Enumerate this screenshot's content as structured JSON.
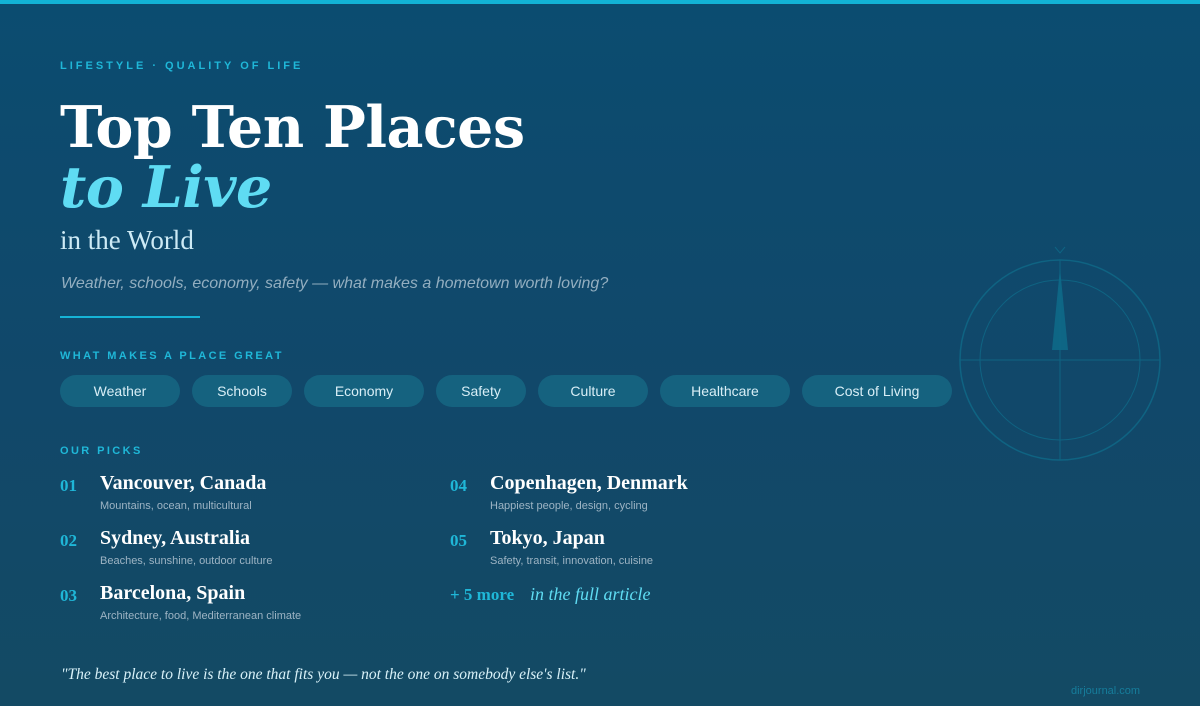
{
  "eyebrow": "LIFESTYLE · QUALITY OF LIFE",
  "title": {
    "line1": "Top Ten Places",
    "line2": "to Live",
    "line3": "in the World"
  },
  "subtitle": "Weather, schools, economy, safety — what makes a hometown worth loving?",
  "factors": {
    "label": "WHAT MAKES A PLACE GREAT",
    "items": [
      "Weather",
      "Schools",
      "Economy",
      "Safety",
      "Culture",
      "Healthcare",
      "Cost of Living"
    ]
  },
  "picks": {
    "label": "OUR PICKS",
    "items": [
      {
        "num": "01",
        "name": "Vancouver, Canada",
        "desc": "Mountains, ocean, multicultural"
      },
      {
        "num": "02",
        "name": "Sydney, Australia",
        "desc": "Beaches, sunshine, outdoor culture"
      },
      {
        "num": "03",
        "name": "Barcelona, Spain",
        "desc": "Architecture, food, Mediterranean climate"
      },
      {
        "num": "04",
        "name": "Copenhagen, Denmark",
        "desc": "Happiest people, design, cycling"
      },
      {
        "num": "05",
        "name": "Tokyo, Japan",
        "desc": "Safety, transit, innovation, cuisine"
      }
    ],
    "more_count": "+ 5 more",
    "more_text": "in the full article"
  },
  "quote": "\"The best place to live is the one that fits you — not the one on somebody else's list.\"",
  "credit": "dirjournal.com",
  "icons": {
    "compass": "compass-icon"
  },
  "colors": {
    "accent": "#1fb7d8",
    "highlight": "#5fdcf3",
    "background": "#0b4c70"
  }
}
